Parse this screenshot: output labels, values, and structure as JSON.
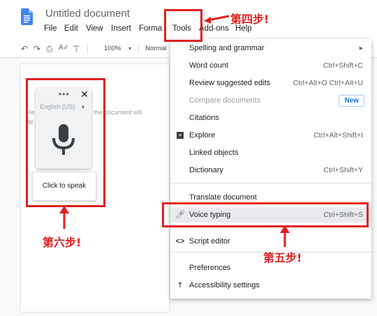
{
  "app": {
    "title": "Untitled document"
  },
  "menubar": [
    "File",
    "Edit",
    "View",
    "Insert",
    "Forma",
    "Tools",
    "Add-ons",
    "Help"
  ],
  "toolbar": {
    "zoom": "100%",
    "style": "Normal"
  },
  "document": {
    "snippet_left": "He",
    "snippet_left2": "ap",
    "snippet_right": "the document will"
  },
  "voice_typing": {
    "language": "English (US)",
    "click_to_speak": "Click to speak"
  },
  "tools_menu": {
    "items": [
      {
        "label": "Spelling and grammar",
        "shortcut": "▸"
      },
      {
        "label": "Word count",
        "shortcut": "Ctrl+Shift+C"
      },
      {
        "label": "Review suggested edits",
        "shortcut": "Ctrl+Alt+O Ctrl+Alt+U"
      },
      {
        "label": "Compare documents",
        "badge": "New"
      },
      {
        "label": "Citations"
      },
      {
        "label": "Explore",
        "shortcut": "Ctrl+Alt+Shift+I"
      },
      {
        "label": "Linked objects"
      },
      {
        "label": "Dictionary",
        "shortcut": "Ctrl+Shift+Y"
      },
      {
        "label": "Translate document"
      },
      {
        "label": "Voice typing",
        "shortcut": "Ctrl+Shift+S"
      },
      {
        "label": "Script editor"
      },
      {
        "label": "Preferences"
      },
      {
        "label": "Accessibility settings"
      }
    ]
  },
  "annotations": {
    "step4": "第四步!",
    "step5": "第五步!",
    "step6": "第六步!"
  },
  "colors": {
    "annotation_red": "#e01f1f",
    "docs_blue": "#4285f4",
    "new_badge": "#1a73e8"
  }
}
